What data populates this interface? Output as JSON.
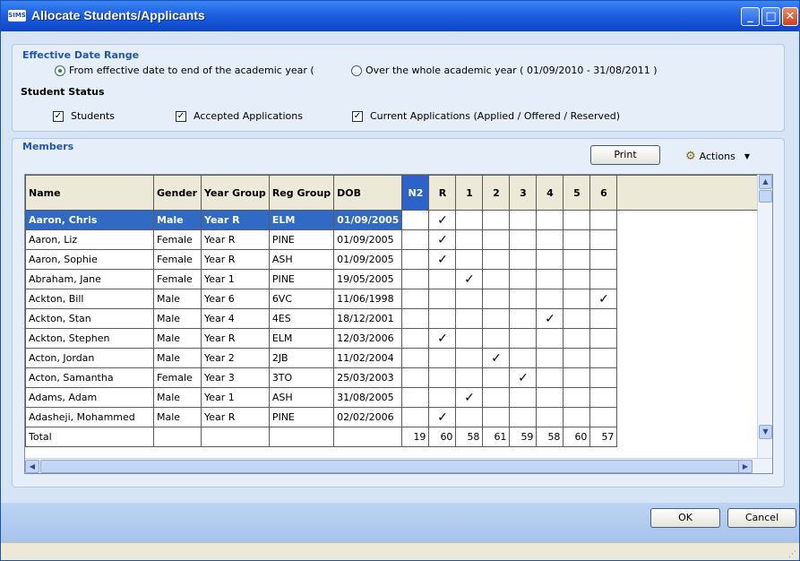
{
  "window": {
    "app_icon_text": "SIMS",
    "title": "Allocate Students/Applicants"
  },
  "effective_date_range": {
    "title": "Effective Date Range",
    "option_from": "From effective date to end of the academic year (",
    "option_whole": "Over the whole academic year ( 01/09/2010 - 31/08/2011 )"
  },
  "student_status": {
    "title": "Student Status",
    "students": "Students",
    "accepted": "Accepted Applications",
    "current": "Current Applications (Applied / Offered / Reserved)"
  },
  "members": {
    "title": "Members",
    "print_label": "Print",
    "actions_label": "Actions"
  },
  "grid": {
    "headers": {
      "name": "Name",
      "gender": "Gender",
      "year_group": "Year Group",
      "reg_group": "Reg Group",
      "dob": "DOB",
      "years": [
        "N2",
        "R",
        "1",
        "2",
        "3",
        "4",
        "5",
        "6"
      ]
    },
    "check_mark": "✓",
    "rows": [
      {
        "name": "Aaron, Chris",
        "gender": "Male",
        "year_group": "Year  R",
        "reg_group": "ELM",
        "dob": "01/09/2005",
        "year": "R"
      },
      {
        "name": "Aaron, Liz",
        "gender": "Female",
        "year_group": "Year R",
        "reg_group": "PINE",
        "dob": "01/09/2005",
        "year": "R"
      },
      {
        "name": "Aaron, Sophie",
        "gender": "Female",
        "year_group": "Year R",
        "reg_group": "ASH",
        "dob": "01/09/2005",
        "year": "R"
      },
      {
        "name": "Abraham, Jane",
        "gender": "Female",
        "year_group": "Year 1",
        "reg_group": "PINE",
        "dob": "19/05/2005",
        "year": "1"
      },
      {
        "name": "Ackton, Bill",
        "gender": "Male",
        "year_group": "Year 6",
        "reg_group": "6VC",
        "dob": "11/06/1998",
        "year": "6"
      },
      {
        "name": "Ackton, Stan",
        "gender": "Male",
        "year_group": "Year 4",
        "reg_group": "4ES",
        "dob": "18/12/2001",
        "year": "4"
      },
      {
        "name": "Ackton, Stephen",
        "gender": "Male",
        "year_group": "Year R",
        "reg_group": "ELM",
        "dob": "12/03/2006",
        "year": "R"
      },
      {
        "name": "Acton, Jordan",
        "gender": "Male",
        "year_group": "Year 2",
        "reg_group": "2JB",
        "dob": "11/02/2004",
        "year": "2"
      },
      {
        "name": "Acton, Samantha",
        "gender": "Female",
        "year_group": "Year 3",
        "reg_group": "3TO",
        "dob": "25/03/2003",
        "year": "3"
      },
      {
        "name": "Adams, Adam",
        "gender": "Male",
        "year_group": "Year 1",
        "reg_group": "ASH",
        "dob": "31/08/2005",
        "year": "1"
      },
      {
        "name": "Adasheji, Mohammed",
        "gender": "Male",
        "year_group": "Year R",
        "reg_group": "PINE",
        "dob": "02/02/2006",
        "year": "R"
      }
    ],
    "total_label": "Total",
    "totals": [
      "19",
      "60",
      "58",
      "61",
      "59",
      "58",
      "60",
      "57"
    ]
  },
  "buttons": {
    "ok": "OK",
    "cancel": "Cancel"
  }
}
